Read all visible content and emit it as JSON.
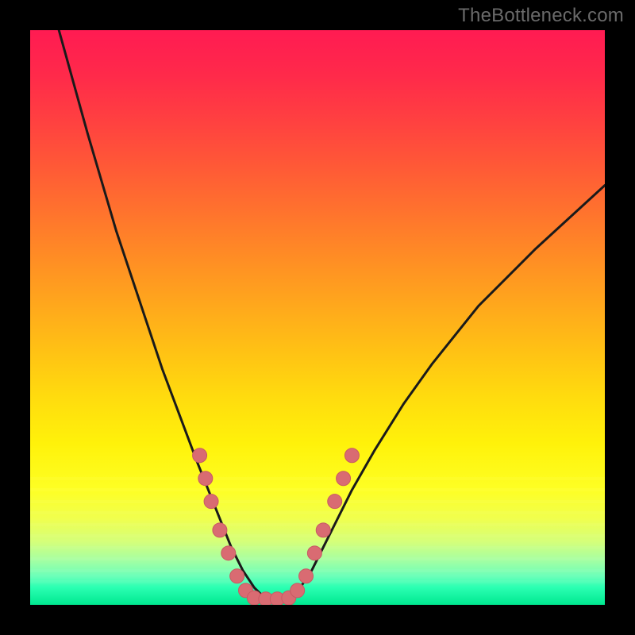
{
  "watermark": "TheBottleneck.com",
  "colors": {
    "marker_fill": "#d96b72",
    "marker_stroke": "#c85a63",
    "curve_stroke": "#1a1a1a",
    "frame_bg": "#000000"
  },
  "chart_data": {
    "type": "line",
    "title": "",
    "xlabel": "",
    "ylabel": "",
    "xlim": [
      0,
      100
    ],
    "ylim": [
      0,
      100
    ],
    "grid": false,
    "legend": false,
    "series": [
      {
        "name": "bottleneck-curve",
        "comment": "V-shaped curve; y approximates bottleneck percentage, minimum (~0) around x≈38–46, rising steeply toward x→0 and moderately toward x→100.",
        "x": [
          5,
          10,
          15,
          20,
          23,
          26,
          29,
          31,
          33,
          35,
          37,
          39,
          41,
          43,
          45,
          47,
          49,
          51,
          53,
          56,
          60,
          65,
          70,
          78,
          88,
          100
        ],
        "y": [
          100,
          82,
          65,
          50,
          41,
          33,
          25,
          20,
          15,
          10,
          6,
          3,
          1,
          1,
          1,
          3,
          6,
          10,
          14,
          20,
          27,
          35,
          42,
          52,
          62,
          73
        ]
      }
    ],
    "markers": {
      "comment": "Salmon dots clustered near the valley on both flanks and along the flat bottom.",
      "points": [
        {
          "x": 29.5,
          "y": 26
        },
        {
          "x": 30.5,
          "y": 22
        },
        {
          "x": 31.5,
          "y": 18
        },
        {
          "x": 33.0,
          "y": 13
        },
        {
          "x": 34.5,
          "y": 9
        },
        {
          "x": 36.0,
          "y": 5
        },
        {
          "x": 37.5,
          "y": 2.5
        },
        {
          "x": 39.0,
          "y": 1.2
        },
        {
          "x": 41.0,
          "y": 1.0
        },
        {
          "x": 43.0,
          "y": 1.0
        },
        {
          "x": 45.0,
          "y": 1.2
        },
        {
          "x": 46.5,
          "y": 2.5
        },
        {
          "x": 48.0,
          "y": 5
        },
        {
          "x": 49.5,
          "y": 9
        },
        {
          "x": 51.0,
          "y": 13
        },
        {
          "x": 53.0,
          "y": 18
        },
        {
          "x": 54.5,
          "y": 22
        },
        {
          "x": 56.0,
          "y": 26
        }
      ],
      "radius": 9
    },
    "bottom_bands_y_percent": [
      78,
      80,
      82,
      84,
      86,
      88,
      90,
      92,
      94,
      96
    ]
  }
}
